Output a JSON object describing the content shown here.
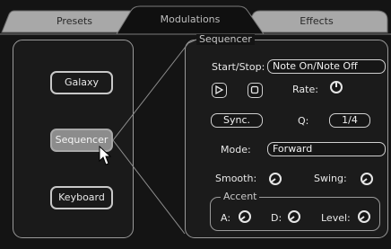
{
  "tabs": [
    {
      "label": "Presets",
      "state": "inactive"
    },
    {
      "label": "Modulations",
      "state": "active"
    },
    {
      "label": "Effects",
      "state": "inactive"
    }
  ],
  "sources": {
    "galaxy_label": "Galaxy",
    "sequencer_label": "Sequencer",
    "keyboard_label": "Keyboard",
    "selected": "Sequencer"
  },
  "sequencer": {
    "title": "Sequencer",
    "start_stop_label": "Start/Stop:",
    "start_stop_value": "Note On/Note Off",
    "rate_label": "Rate:",
    "sync_label": "Sync.",
    "q_label": "Q:",
    "q_value": "1/4",
    "mode_label": "Mode:",
    "mode_value": "Forward",
    "smooth_label": "Smooth:",
    "swing_label": "Swing:"
  },
  "accent": {
    "title": "Accent",
    "a_label": "A:",
    "d_label": "D:",
    "level_label": "Level:"
  },
  "colors": {
    "background": "#141414",
    "panel": "#1b1b1b",
    "inactive_tab": "#a8a8a8",
    "active_tab": "#101010",
    "selected_button": "#8c8c8c",
    "outline": "#cfcfcf"
  }
}
